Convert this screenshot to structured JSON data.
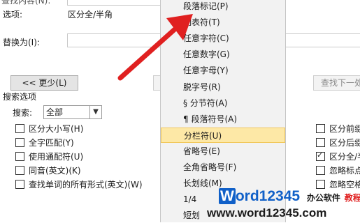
{
  "dialog": {
    "row0_label": "查找内容(N):",
    "row1_label": "选项:",
    "row1_value": "区分全/半角",
    "replace_label": "替换为(I):",
    "less_button": "<< 更少(L)",
    "find_next_button": "查找下一处",
    "search_options_label": "搜索选项",
    "search_label": "搜索:",
    "search_value": "全部",
    "left_options": [
      {
        "label": "区分大小写(H)",
        "checked": false
      },
      {
        "label": "全字匹配(Y)",
        "checked": false
      },
      {
        "label": "使用通配符(U)",
        "checked": false
      },
      {
        "label": "同音(英文)(K)",
        "checked": false
      },
      {
        "label": "查找单词的所有形式(英文)(W)",
        "checked": false
      }
    ],
    "right_options": [
      {
        "label": "区分前缀",
        "checked": false
      },
      {
        "label": "区分后缀",
        "checked": false
      },
      {
        "label": "区分全/半",
        "checked": true
      },
      {
        "label": "忽略标点",
        "checked": false
      },
      {
        "label": "忽略空格",
        "checked": false
      }
    ]
  },
  "menu": {
    "items": [
      {
        "label": "段落标记(P)",
        "highlighted": false
      },
      {
        "label": "制表符(T)",
        "highlighted": false
      },
      {
        "label": "任意字符(C)",
        "highlighted": false
      },
      {
        "label": "任意数字(G)",
        "highlighted": false
      },
      {
        "label": "任意字母(Y)",
        "highlighted": false
      },
      {
        "label": "脱字号(R)",
        "highlighted": false
      },
      {
        "label": "§ 分节符(A)",
        "highlighted": false
      },
      {
        "label": "¶ 段落符号(A)",
        "highlighted": false
      },
      {
        "label": "分栏符(U)",
        "highlighted": true
      },
      {
        "label": "省略号(E)",
        "highlighted": false
      },
      {
        "label": "全角省略号(F)",
        "highlighted": false
      },
      {
        "label": "长划线(M)",
        "highlighted": false
      },
      {
        "label": "1/4",
        "highlighted": false
      },
      {
        "label": "短划",
        "highlighted": false
      }
    ]
  },
  "watermark": {
    "brand_prefix": "W",
    "brand_rest": "ord12345",
    "slogan": "办公软件",
    "slogan_suffix": "教程",
    "url": "www.word12345.com"
  },
  "colors": {
    "arrow": "#e02020",
    "highlight": "#fde8a6",
    "brand_blue": "#1060c8"
  }
}
